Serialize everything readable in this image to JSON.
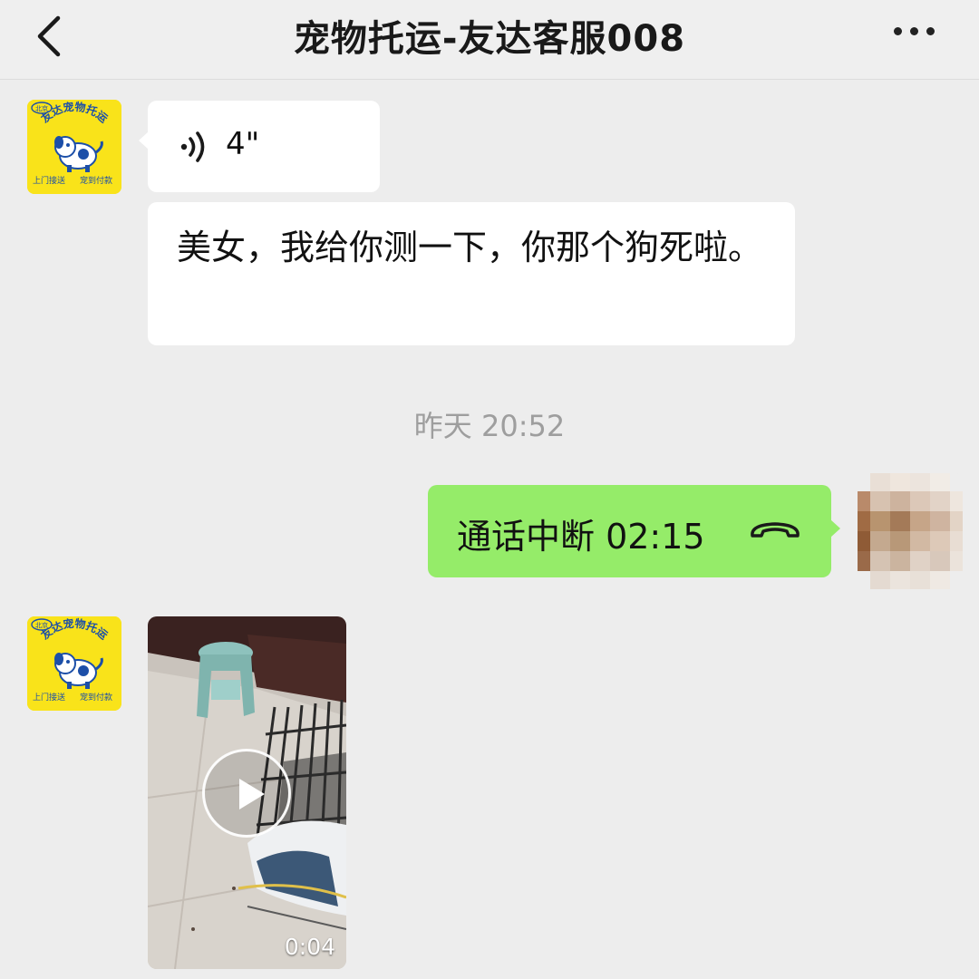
{
  "header": {
    "title": "宠物托运-友达客服008",
    "back_icon": "chevron-left-icon",
    "more_icon": "more-dots-icon"
  },
  "contact_avatar": {
    "top_text": "北京",
    "arc_text": "友达宠物托运",
    "left_tag": "上门接送",
    "right_tag": "宠到付款",
    "background": "#f9e31a",
    "accent": "#1c4fa8"
  },
  "messages": [
    {
      "type": "voice",
      "from": "contact",
      "duration": "4\""
    },
    {
      "type": "text",
      "from": "contact",
      "text": "美女，我给你测一下，你那个狗死啦。"
    },
    {
      "type": "timestamp",
      "text": "昨天 20:52"
    },
    {
      "type": "call",
      "from": "self",
      "text": "通话中断 02:15",
      "icon": "phone-hangup-icon"
    },
    {
      "type": "video",
      "from": "contact",
      "duration": "0:04",
      "icon": "play-icon"
    }
  ],
  "colors": {
    "page_background": "#ededed",
    "incoming_bubble": "#ffffff",
    "outgoing_bubble": "#95ec69",
    "timestamp_text": "#9e9e9e"
  }
}
